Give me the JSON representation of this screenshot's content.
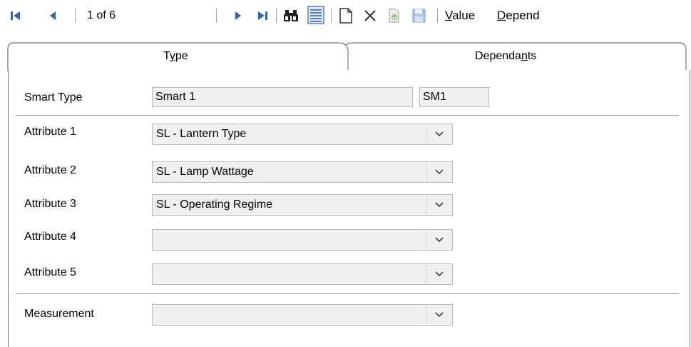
{
  "toolbar": {
    "first_icon": "first-record-icon",
    "prev_icon": "previous-record-icon",
    "record_counter": "1 of 6",
    "next_icon": "next-record-icon",
    "last_icon": "last-record-icon",
    "find_icon": "binoculars-icon",
    "list_icon": "list-view-icon",
    "new_icon": "new-document-icon",
    "delete_icon": "delete-x-icon",
    "copy_icon": "copy-record-icon",
    "save_icon": "save-disk-icon",
    "value_label_accel": "V",
    "value_label_rest": "alue",
    "depend_label_accel": "D",
    "depend_label_rest": "epend"
  },
  "tabs": {
    "type_label_pre": "T",
    "type_label_accel": "y",
    "type_label_post": "pe",
    "dependants_label_pre": "Dependa",
    "dependants_label_accel": "n",
    "dependants_label_post": "ts"
  },
  "form": {
    "smart_type": {
      "label": "Smart Type",
      "name_value": "Smart 1",
      "code_value": "SM1"
    },
    "attributes": [
      {
        "label": "Attribute 1",
        "value": "SL - Lantern Type"
      },
      {
        "label": "Attribute 2",
        "value": "SL - Lamp Wattage"
      },
      {
        "label": "Attribute 3",
        "value": "SL - Operating Regime"
      },
      {
        "label": "Attribute 4",
        "value": ""
      },
      {
        "label": "Attribute 5",
        "value": ""
      }
    ],
    "measurement": {
      "label": "Measurement",
      "value": ""
    }
  },
  "colors": {
    "nav_blue": "#2f66b3",
    "save_blue": "#4a7fd1"
  }
}
